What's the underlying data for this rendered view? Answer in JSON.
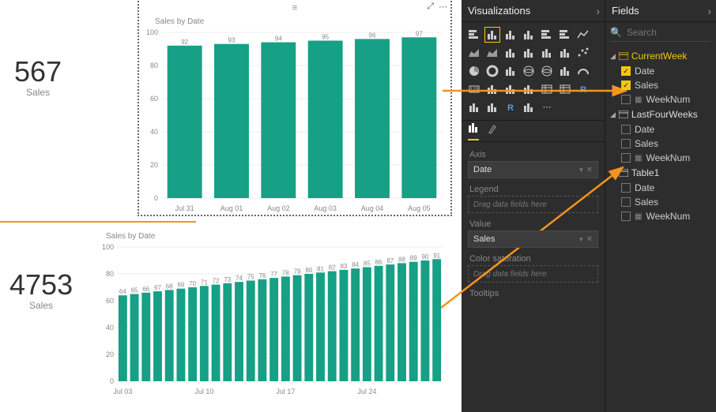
{
  "card1": {
    "value": "567",
    "label": "Sales"
  },
  "card2": {
    "value": "4753",
    "label": "Sales"
  },
  "chart1": {
    "title": "Sales by Date"
  },
  "chart2": {
    "title": "Sales by Date"
  },
  "panels": {
    "visualizations": "Visualizations",
    "fields": "Fields",
    "search_ph": "Search"
  },
  "wells": {
    "axis": "Axis",
    "axis_val": "Date",
    "legend": "Legend",
    "legend_hint": "Drag data fields here",
    "value": "Value",
    "value_val": "Sales",
    "colorsat": "Color saturation",
    "colorsat_hint": "Drag data fields here",
    "tooltips": "Tooltips"
  },
  "tables": {
    "t1": "CurrentWeek",
    "t1_f1": "Date",
    "t1_f2": "Sales",
    "t1_f3": "WeekNum",
    "t2": "LastFourWeeks",
    "t2_f1": "Date",
    "t2_f2": "Sales",
    "t2_f3": "WeekNum",
    "t3": "Table1",
    "t3_f1": "Date",
    "t3_f2": "Sales",
    "t3_f3": "WeekNum"
  },
  "chart_data": [
    {
      "type": "bar",
      "title": "Sales by Date",
      "categories": [
        "Jul 31",
        "Aug 01",
        "Aug 02",
        "Aug 03",
        "Aug 04",
        "Aug 05"
      ],
      "values": [
        92,
        93,
        94,
        95,
        96,
        97
      ],
      "ylim": [
        0,
        100
      ],
      "yticks": [
        0,
        20,
        40,
        60,
        80,
        100
      ],
      "xlabel": "",
      "ylabel": ""
    },
    {
      "type": "bar",
      "title": "Sales by Date",
      "categories": [
        "Jul 03",
        "Jul 04",
        "Jul 05",
        "Jul 06",
        "Jul 07",
        "Jul 08",
        "Jul 09",
        "Jul 10",
        "Jul 11",
        "Jul 12",
        "Jul 13",
        "Jul 14",
        "Jul 15",
        "Jul 16",
        "Jul 17",
        "Jul 18",
        "Jul 19",
        "Jul 20",
        "Jul 21",
        "Jul 22",
        "Jul 23",
        "Jul 24",
        "Jul 25",
        "Jul 26",
        "Jul 27",
        "Jul 28",
        "Jul 29",
        "Jul 30"
      ],
      "values": [
        64,
        65,
        66,
        67,
        68,
        69,
        70,
        71,
        72,
        73,
        74,
        75,
        76,
        77,
        78,
        79,
        80,
        81,
        82,
        83,
        84,
        85,
        86,
        87,
        88,
        89,
        90,
        91
      ],
      "data_labels_start_index": 0,
      "xticks_shown": [
        "Jul 03",
        "Jul 10",
        "Jul 17",
        "Jul 24"
      ],
      "ylim": [
        0,
        100
      ],
      "yticks": [
        0,
        20,
        40,
        60,
        80,
        100
      ],
      "xlabel": "",
      "ylabel": ""
    }
  ]
}
